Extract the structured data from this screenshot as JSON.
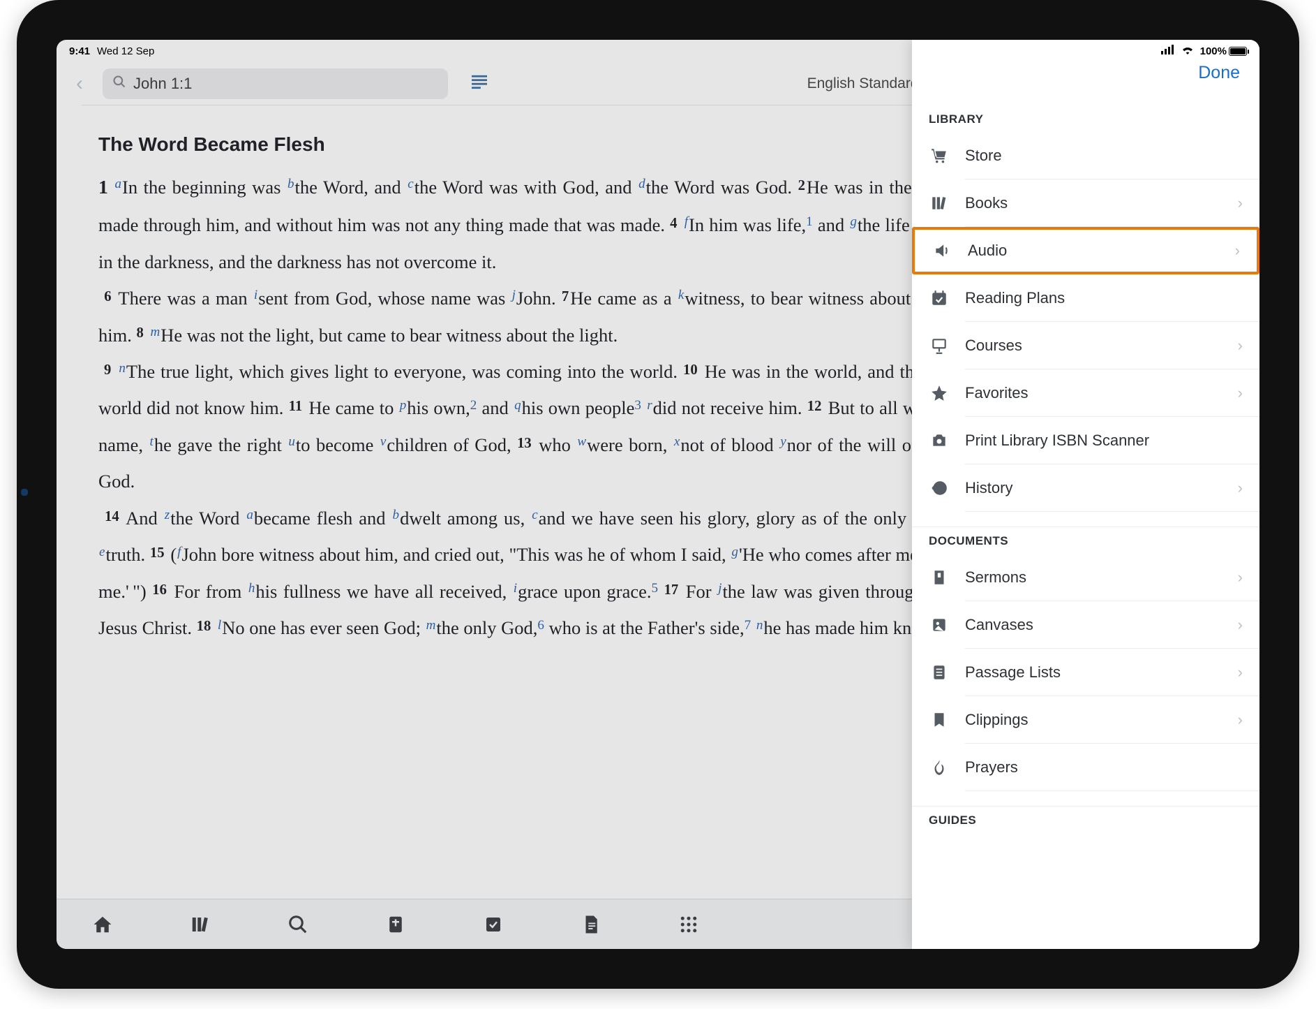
{
  "status": {
    "time": "9:41",
    "date": "Wed 12 Sep",
    "battery": "100%"
  },
  "header": {
    "search_value": "John 1:1",
    "version": "English Standard Vers"
  },
  "passage": {
    "title": "The Word Became Flesh"
  },
  "sidebar": {
    "done": "Done",
    "library_title": "LIBRARY",
    "documents_title": "DOCUMENTS",
    "guides_title": "GUIDES",
    "items": {
      "store": "Store",
      "books": "Books",
      "audio": "Audio",
      "reading_plans": "Reading Plans",
      "courses": "Courses",
      "favorites": "Favorites",
      "isbn": "Print Library ISBN Scanner",
      "history": "History",
      "sermons": "Sermons",
      "canvases": "Canvases",
      "passage_lists": "Passage Lists",
      "clippings": "Clippings",
      "prayers": "Prayers"
    }
  }
}
